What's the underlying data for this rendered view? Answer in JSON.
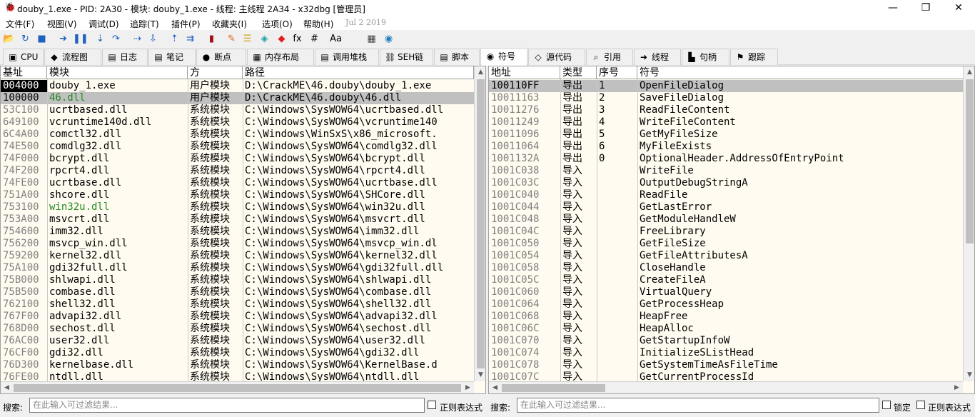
{
  "window": {
    "title": "douby_1.exe - PID: 2A30 - 模块: douby_1.exe - 线程: 主线程 2A34 - x32dbg [管理员]",
    "minimize": "—",
    "restore": "❐",
    "close": "✕",
    "app_icon": "bug-icon"
  },
  "menu": {
    "items": [
      "文件(F)",
      "视图(V)",
      "调试(D)",
      "追踪(T)",
      "插件(P)",
      "收藏夹(I)",
      "选项(O)",
      "帮助(H)"
    ],
    "date": "Jul 2 2019"
  },
  "toolbar": {
    "icons": [
      {
        "name": "open-icon",
        "glyph": "📂",
        "color": "#d4a017"
      },
      {
        "name": "restart-icon",
        "glyph": "↻",
        "color": "#2060c0"
      },
      {
        "name": "stop-icon",
        "glyph": "■",
        "color": "#2060c0"
      },
      {
        "name": "run-icon",
        "glyph": "➜",
        "color": "#2060c0"
      },
      {
        "name": "pause-icon",
        "glyph": "❚❚",
        "color": "#2060c0"
      },
      {
        "name": "step-into-icon",
        "glyph": "⇣",
        "color": "#2060c0"
      },
      {
        "name": "step-over-icon",
        "glyph": "↷",
        "color": "#2060c0"
      },
      {
        "name": "trace-into-icon",
        "glyph": "⇢",
        "color": "#2060c0"
      },
      {
        "name": "trace-over-icon",
        "glyph": "⇩",
        "color": "#2060c0"
      },
      {
        "name": "execute-till-return-icon",
        "glyph": "⇡",
        "color": "#2060c0"
      },
      {
        "name": "run-to-user-code-icon",
        "glyph": "⇉",
        "color": "#2060c0"
      },
      {
        "name": "scylla-icon",
        "glyph": "▮",
        "color": "#a01010"
      },
      {
        "name": "patch-icon",
        "glyph": "✎",
        "color": "#e06020"
      },
      {
        "name": "comment-icon",
        "glyph": "☰",
        "color": "#d4a017"
      },
      {
        "name": "label-icon",
        "glyph": "◈",
        "color": "#20a0a0"
      },
      {
        "name": "bookmark-icon",
        "glyph": "◆",
        "color": "#e02020"
      },
      {
        "name": "function-icon",
        "glyph": "fx",
        "color": "#000000"
      },
      {
        "name": "hash-icon",
        "glyph": "#",
        "color": "#000000"
      },
      {
        "name": "font-icon",
        "glyph": "Aa",
        "color": "#000000"
      },
      {
        "name": "calculator-icon",
        "glyph": "▦",
        "color": "#404040"
      },
      {
        "name": "globe-icon",
        "glyph": "◉",
        "color": "#2080c0"
      }
    ]
  },
  "tabs": [
    {
      "label": "CPU",
      "icon": "cpu-icon",
      "glyph": "▣"
    },
    {
      "label": "流程图",
      "icon": "graph-icon",
      "glyph": "◆"
    },
    {
      "label": "日志",
      "icon": "log-icon",
      "glyph": "▤"
    },
    {
      "label": "笔记",
      "icon": "notes-icon",
      "glyph": "▤"
    },
    {
      "label": "断点",
      "icon": "breakpoint-icon",
      "glyph": "●"
    },
    {
      "label": "内存布局",
      "icon": "memory-map-icon",
      "glyph": "▦"
    },
    {
      "label": "调用堆栈",
      "icon": "call-stack-icon",
      "glyph": "▤"
    },
    {
      "label": "SEH链",
      "icon": "seh-chain-icon",
      "glyph": "⛓"
    },
    {
      "label": "脚本",
      "icon": "script-icon",
      "glyph": "▤"
    },
    {
      "label": "符号",
      "icon": "symbols-icon",
      "glyph": "◉"
    },
    {
      "label": "源代码",
      "icon": "source-icon",
      "glyph": "◇"
    },
    {
      "label": "引用",
      "icon": "references-icon",
      "glyph": "⌕"
    },
    {
      "label": "线程",
      "icon": "threads-icon",
      "glyph": "➜"
    },
    {
      "label": "句柄",
      "icon": "handles-icon",
      "glyph": "▙"
    },
    {
      "label": "跟踪",
      "icon": "trace-icon",
      "glyph": "⚑"
    }
  ],
  "active_tab": "符号",
  "modules": {
    "headers": [
      "基址",
      "模块",
      "方",
      "路径"
    ],
    "rows": [
      {
        "base": "004000",
        "module": "douby_1.exe",
        "party": "用户模块",
        "path": "D:\\CrackME\\46.douby\\douby_1.exe",
        "style": "user-black"
      },
      {
        "base": "100000",
        "module": "46.dll",
        "party": "用户模块",
        "path": "D:\\CrackME\\46.douby\\46.dll",
        "style": "selected-green"
      },
      {
        "base": "53C100",
        "module": "ucrtbased.dll",
        "party": "系统模块",
        "path": "C:\\Windows\\SysWOW64\\ucrtbased.dll",
        "style": "system"
      },
      {
        "base": "649100",
        "module": "vcruntime140d.dll",
        "party": "系统模块",
        "path": "C:\\Windows\\SysWOW64\\vcruntime140",
        "style": "system"
      },
      {
        "base": "6C4A00",
        "module": "comctl32.dll",
        "party": "系统模块",
        "path": "C:\\Windows\\WinSxS\\x86_microsoft.",
        "style": "system"
      },
      {
        "base": "74E500",
        "module": "comdlg32.dll",
        "party": "系统模块",
        "path": "C:\\Windows\\SysWOW64\\comdlg32.dll",
        "style": "system"
      },
      {
        "base": "74F000",
        "module": "bcrypt.dll",
        "party": "系统模块",
        "path": "C:\\Windows\\SysWOW64\\bcrypt.dll",
        "style": "system"
      },
      {
        "base": "74F200",
        "module": "rpcrt4.dll",
        "party": "系统模块",
        "path": "C:\\Windows\\SysWOW64\\rpcrt4.dll",
        "style": "system"
      },
      {
        "base": "74FE00",
        "module": "ucrtbase.dll",
        "party": "系统模块",
        "path": "C:\\Windows\\SysWOW64\\ucrtbase.dll",
        "style": "system"
      },
      {
        "base": "751A00",
        "module": "shcore.dll",
        "party": "系统模块",
        "path": "C:\\Windows\\SysWOW64\\SHCore.dll",
        "style": "system"
      },
      {
        "base": "753100",
        "module": "win32u.dll",
        "party": "系统模块",
        "path": "C:\\Windows\\SysWOW64\\win32u.dll",
        "style": "system-green"
      },
      {
        "base": "753A00",
        "module": "msvcrt.dll",
        "party": "系统模块",
        "path": "C:\\Windows\\SysWOW64\\msvcrt.dll",
        "style": "system"
      },
      {
        "base": "754600",
        "module": "imm32.dll",
        "party": "系统模块",
        "path": "C:\\Windows\\SysWOW64\\imm32.dll",
        "style": "system"
      },
      {
        "base": "756200",
        "module": "msvcp_win.dll",
        "party": "系统模块",
        "path": "C:\\Windows\\SysWOW64\\msvcp_win.dl",
        "style": "system"
      },
      {
        "base": "759200",
        "module": "kernel32.dll",
        "party": "系统模块",
        "path": "C:\\Windows\\SysWOW64\\kernel32.dll",
        "style": "system"
      },
      {
        "base": "75A100",
        "module": "gdi32full.dll",
        "party": "系统模块",
        "path": "C:\\Windows\\SysWOW64\\gdi32full.dll",
        "style": "system"
      },
      {
        "base": "75B000",
        "module": "shlwapi.dll",
        "party": "系统模块",
        "path": "C:\\Windows\\SysWOW64\\shlwapi.dll",
        "style": "system"
      },
      {
        "base": "75B500",
        "module": "combase.dll",
        "party": "系统模块",
        "path": "C:\\Windows\\SysWOW64\\combase.dll",
        "style": "system"
      },
      {
        "base": "762100",
        "module": "shell32.dll",
        "party": "系统模块",
        "path": "C:\\Windows\\SysWOW64\\shell32.dll",
        "style": "system"
      },
      {
        "base": "767F00",
        "module": "advapi32.dll",
        "party": "系统模块",
        "path": "C:\\Windows\\SysWOW64\\advapi32.dll",
        "style": "system"
      },
      {
        "base": "768D00",
        "module": "sechost.dll",
        "party": "系统模块",
        "path": "C:\\Windows\\SysWOW64\\sechost.dll",
        "style": "system"
      },
      {
        "base": "76AC00",
        "module": "user32.dll",
        "party": "系统模块",
        "path": "C:\\Windows\\SysWOW64\\user32.dll",
        "style": "system"
      },
      {
        "base": "76CF00",
        "module": "gdi32.dll",
        "party": "系统模块",
        "path": "C:\\Windows\\SysWOW64\\gdi32.dll",
        "style": "system"
      },
      {
        "base": "76D300",
        "module": "kernelbase.dll",
        "party": "系统模块",
        "path": "C:\\Windows\\SysWOW64\\KernelBase.d",
        "style": "system"
      },
      {
        "base": "76FE00",
        "module": "ntdll.dll",
        "party": "系统模块",
        "path": "C:\\Windows\\SysWOW64\\ntdll.dll",
        "style": "system"
      }
    ]
  },
  "symbols": {
    "headers": [
      "地址",
      "类型",
      "序号",
      "符号"
    ],
    "rows": [
      {
        "addr": "100110FF",
        "type": "导出",
        "ord": "1",
        "sym": "OpenFileDialog",
        "sel": true
      },
      {
        "addr": "10011163",
        "type": "导出",
        "ord": "2",
        "sym": "SaveFileDialog"
      },
      {
        "addr": "10011276",
        "type": "导出",
        "ord": "3",
        "sym": "ReadFileContent"
      },
      {
        "addr": "10011249",
        "type": "导出",
        "ord": "4",
        "sym": "WriteFileContent"
      },
      {
        "addr": "10011096",
        "type": "导出",
        "ord": "5",
        "sym": "GetMyFileSize"
      },
      {
        "addr": "10011064",
        "type": "导出",
        "ord": "6",
        "sym": "MyFileExists"
      },
      {
        "addr": "1001132A",
        "type": "导出",
        "ord": "0",
        "sym": "OptionalHeader.AddressOfEntryPoint"
      },
      {
        "addr": "1001C038",
        "type": "导入",
        "ord": "",
        "sym": "WriteFile"
      },
      {
        "addr": "1001C03C",
        "type": "导入",
        "ord": "",
        "sym": "OutputDebugStringA"
      },
      {
        "addr": "1001C040",
        "type": "导入",
        "ord": "",
        "sym": "ReadFile"
      },
      {
        "addr": "1001C044",
        "type": "导入",
        "ord": "",
        "sym": "GetLastError"
      },
      {
        "addr": "1001C048",
        "type": "导入",
        "ord": "",
        "sym": "GetModuleHandleW"
      },
      {
        "addr": "1001C04C",
        "type": "导入",
        "ord": "",
        "sym": "FreeLibrary"
      },
      {
        "addr": "1001C050",
        "type": "导入",
        "ord": "",
        "sym": "GetFileSize"
      },
      {
        "addr": "1001C054",
        "type": "导入",
        "ord": "",
        "sym": "GetFileAttributesA"
      },
      {
        "addr": "1001C058",
        "type": "导入",
        "ord": "",
        "sym": "CloseHandle"
      },
      {
        "addr": "1001C05C",
        "type": "导入",
        "ord": "",
        "sym": "CreateFileA"
      },
      {
        "addr": "1001C060",
        "type": "导入",
        "ord": "",
        "sym": "VirtualQuery"
      },
      {
        "addr": "1001C064",
        "type": "导入",
        "ord": "",
        "sym": "GetProcessHeap"
      },
      {
        "addr": "1001C068",
        "type": "导入",
        "ord": "",
        "sym": "HeapFree"
      },
      {
        "addr": "1001C06C",
        "type": "导入",
        "ord": "",
        "sym": "HeapAlloc"
      },
      {
        "addr": "1001C070",
        "type": "导入",
        "ord": "",
        "sym": "GetStartupInfoW"
      },
      {
        "addr": "1001C074",
        "type": "导入",
        "ord": "",
        "sym": "InitializeSListHead"
      },
      {
        "addr": "1001C078",
        "type": "导入",
        "ord": "",
        "sym": "GetSystemTimeAsFileTime"
      },
      {
        "addr": "1001C07C",
        "type": "导入",
        "ord": "",
        "sym": "GetCurrentProcessId"
      }
    ]
  },
  "bottom": {
    "search_label_left": "搜索:",
    "search_placeholder_left": "在此输入可过滤结果...",
    "regex_label_left": "正则表达式",
    "search_label_right": "搜索:",
    "search_placeholder_right": "在此输入可过滤结果...",
    "lock_label": "锁定",
    "regex_label_right": "正则表达式"
  },
  "colors": {
    "panel_bg": "#fffbf0",
    "selection": "#c0c0c0",
    "green_module": "#228b22",
    "grey_text": "#808080"
  }
}
